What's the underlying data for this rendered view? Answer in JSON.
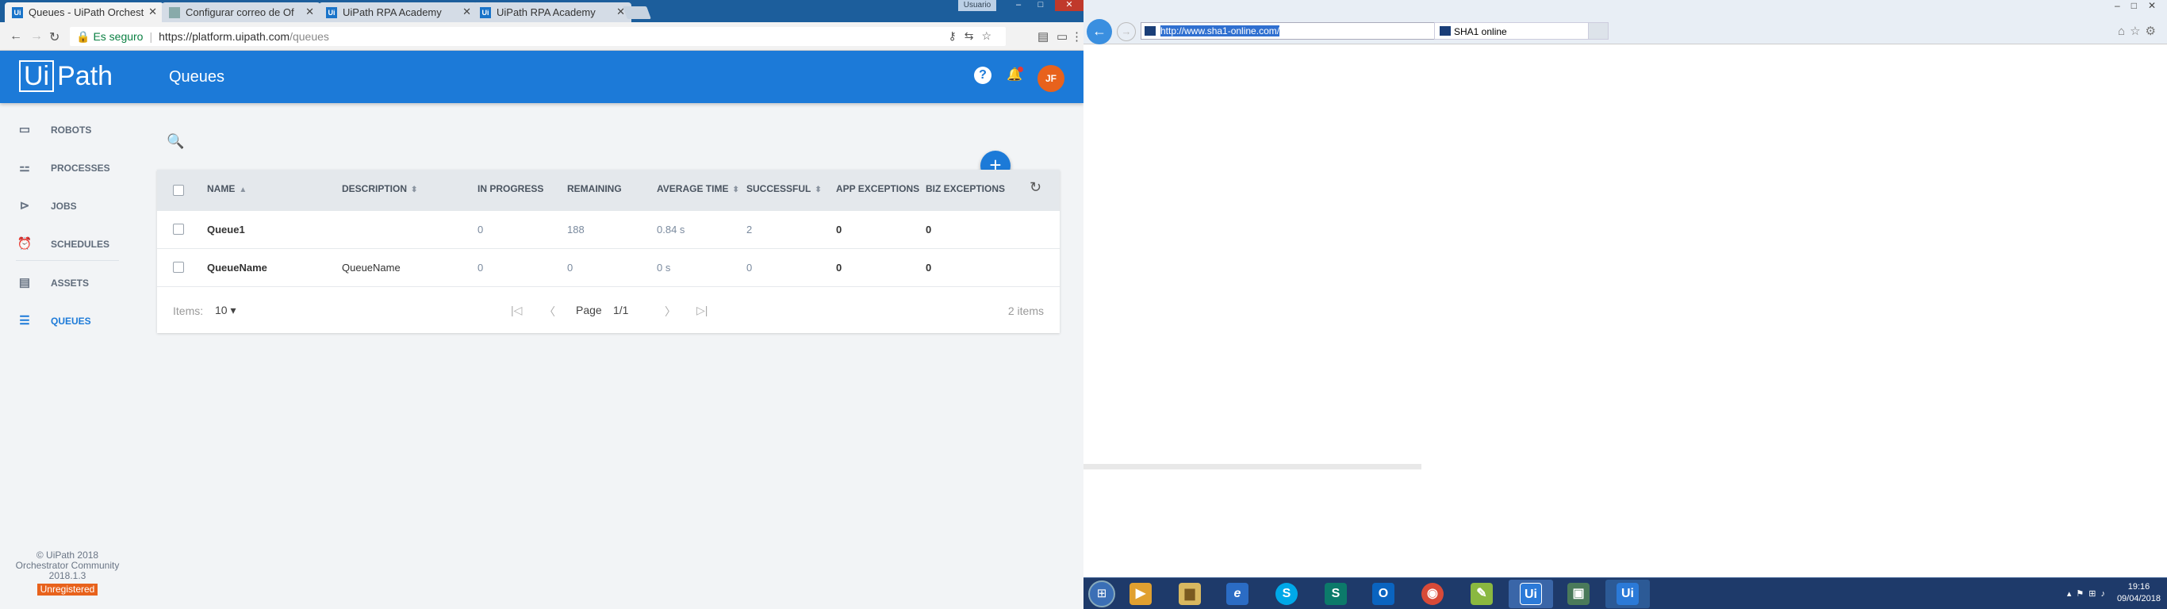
{
  "chrome": {
    "tabs": [
      {
        "title": "Queues - UiPath Orchest",
        "favicon": "Ui"
      },
      {
        "title": "Configurar correo de Of",
        "favicon": ""
      },
      {
        "title": "UiPath RPA Academy",
        "favicon": "Ui"
      },
      {
        "title": "UiPath RPA Academy",
        "favicon": "Ui"
      }
    ],
    "window_user": "Usuario",
    "secure_label": "Es seguro",
    "url_host": "https://platform.uipath.com",
    "url_path": "/queues"
  },
  "header": {
    "logo_box": "Ui",
    "logo_text": "Path",
    "title": "Queues",
    "avatar_initials": "JF",
    "accent": "#1c7ad8"
  },
  "sidebar": {
    "items": [
      {
        "label": "ROBOTS",
        "icon": "monitor-icon"
      },
      {
        "label": "PROCESSES",
        "icon": "sitemap-icon"
      },
      {
        "label": "JOBS",
        "icon": "play-circle-icon"
      },
      {
        "label": "SCHEDULES",
        "icon": "alarm-clock-icon"
      },
      {
        "label": "ASSETS",
        "icon": "assets-icon"
      },
      {
        "label": "QUEUES",
        "icon": "queues-icon"
      }
    ],
    "footer": {
      "line1": "© UiPath 2018",
      "line2": "Orchestrator Community",
      "line3": "2018.1.3",
      "badge": "Unregistered"
    }
  },
  "table": {
    "headers": {
      "name": "NAME",
      "description": "DESCRIPTION",
      "in_progress": "IN PROGRESS",
      "remaining": "REMAINING",
      "average_time": "AVERAGE TIME",
      "successful": "SUCCESSFUL",
      "app_exceptions": "APP EXCEPTIONS",
      "biz_exceptions": "BIZ EXCEPTIONS"
    },
    "rows": [
      {
        "name": "Queue1",
        "description": "",
        "in_progress": "0",
        "remaining": "188",
        "average_time": "0.84 s",
        "successful": "2",
        "app_exceptions": "0",
        "biz_exceptions": "0"
      },
      {
        "name": "QueueName",
        "description": "QueueName",
        "in_progress": "0",
        "remaining": "0",
        "average_time": "0 s",
        "successful": "0",
        "app_exceptions": "0",
        "biz_exceptions": "0"
      }
    ],
    "pager": {
      "items_label": "Items:",
      "page_size": "10",
      "page_label": "Page",
      "page_value": "1/1",
      "count": "2 items"
    }
  },
  "ie": {
    "url": "http://www.sha1-online.com/",
    "tab_title": "SHA1 online"
  },
  "taskbar": {
    "apps": [
      {
        "icon": "media-player-icon",
        "text": "▶"
      },
      {
        "icon": "explorer-icon",
        "text": "▆"
      },
      {
        "icon": "ie-icon",
        "text": "e"
      },
      {
        "icon": "skype-icon",
        "text": "S"
      },
      {
        "icon": "sharepoint-icon",
        "text": "S"
      },
      {
        "icon": "outlook-icon",
        "text": "O"
      },
      {
        "icon": "chrome-icon",
        "text": "◉"
      },
      {
        "icon": "notepad-icon",
        "text": "✎"
      },
      {
        "icon": "uipath-studio-icon",
        "text": "Ui"
      },
      {
        "icon": "remote-desktop-icon",
        "text": "▣"
      },
      {
        "icon": "uipath-robot-icon",
        "text": "Ui"
      }
    ],
    "time": "19:16",
    "date": "09/04/2018"
  }
}
